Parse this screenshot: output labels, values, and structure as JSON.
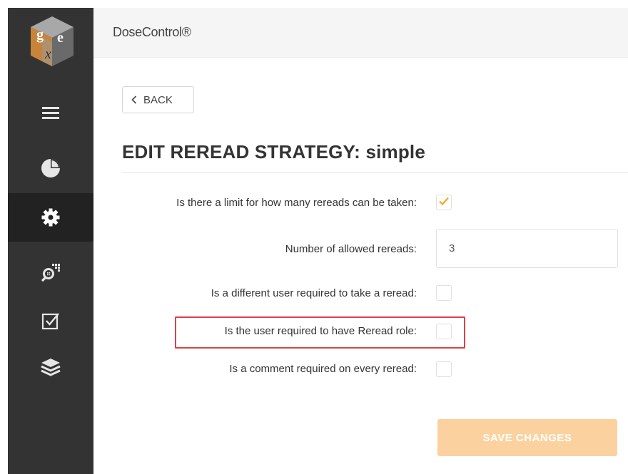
{
  "app": {
    "title": "DoseControl®"
  },
  "sidebar": {
    "logo_icon": "gex-cube-logo-icon",
    "items": [
      {
        "icon": "hamburger-menu-icon",
        "active": false
      },
      {
        "icon": "pie-chart-icon",
        "active": false
      },
      {
        "icon": "gear-icon",
        "active": true
      },
      {
        "icon": "search-grid-icon",
        "active": false
      },
      {
        "icon": "checkbox-icon",
        "active": false
      },
      {
        "icon": "layers-icon",
        "active": false
      }
    ]
  },
  "toolbar": {
    "back_label": "BACK"
  },
  "page": {
    "title": "EDIT REREAD STRATEGY: simple"
  },
  "form": {
    "limit_label": "Is there a limit for how many rereads can be taken:",
    "limit_checked": true,
    "allowed_label": "Number of allowed rereads:",
    "allowed_value": "3",
    "different_user_label": "Is a different user required to take a reread:",
    "different_user_checked": false,
    "reread_role_label": "Is the user required to have Reread role:",
    "reread_role_checked": false,
    "comment_label": "Is a comment required on every reread:",
    "comment_checked": false
  },
  "actions": {
    "save_label": "SAVE CHANGES"
  },
  "colors": {
    "sidebar": "#333333",
    "sidebar_active": "#222222",
    "accent_orange": "#f5a623",
    "save_button_disabled": "#fbd29f",
    "highlight_red": "#d9424b"
  }
}
